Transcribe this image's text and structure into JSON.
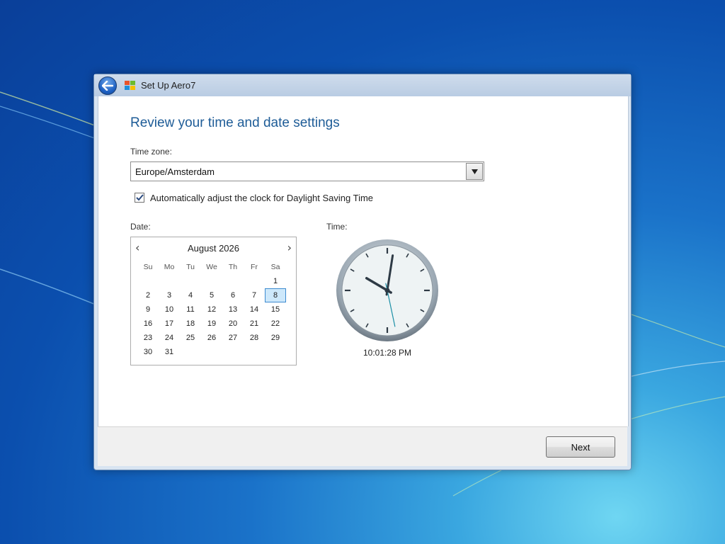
{
  "window": {
    "title": "Set Up Aero7"
  },
  "page": {
    "heading": "Review your time and date settings"
  },
  "timezone": {
    "label": "Time zone:",
    "value": "Europe/Amsterdam"
  },
  "dst": {
    "label": "Automatically adjust the clock for Daylight Saving Time",
    "checked": true
  },
  "date": {
    "label": "Date:",
    "month": "August 2026",
    "prev": "‹",
    "next": "›",
    "weekdays": [
      "Su",
      "Mo",
      "Tu",
      "We",
      "Th",
      "Fr",
      "Sa"
    ],
    "weeks": [
      [
        "",
        "",
        "",
        "",
        "",
        "",
        "1"
      ],
      [
        "2",
        "3",
        "4",
        "5",
        "6",
        "7",
        "8"
      ],
      [
        "9",
        "10",
        "11",
        "12",
        "13",
        "14",
        "15"
      ],
      [
        "16",
        "17",
        "18",
        "19",
        "20",
        "21",
        "22"
      ],
      [
        "23",
        "24",
        "25",
        "26",
        "27",
        "28",
        "29"
      ],
      [
        "30",
        "31",
        "",
        "",
        "",
        "",
        ""
      ]
    ],
    "selected": "8"
  },
  "time": {
    "label": "Time:",
    "value": "10:01:28 PM",
    "hours": 22,
    "minutes": 1,
    "seconds": 28
  },
  "footer": {
    "next_label": "Next"
  },
  "colors": {
    "accent": "#1e5c97",
    "selected_day_bg": "#cde8fb",
    "selected_day_border": "#3d8bd0"
  }
}
